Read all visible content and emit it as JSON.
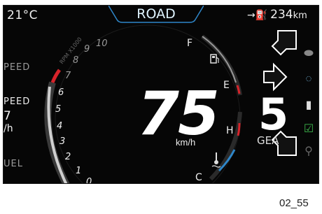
{
  "topbar": {
    "temperature": "21°C",
    "mode": "ROAD",
    "range_value": "234",
    "range_unit": "km"
  },
  "left_panel": {
    "label1": "PEED",
    "label2": "PEED",
    "value": "7",
    "value_unit": "/h",
    "label3": "UEL"
  },
  "tachometer": {
    "label": "RPM X1000",
    "ticks": [
      "0",
      "1",
      "2",
      "3",
      "4",
      "5",
      "6",
      "7",
      "8",
      "9",
      "10"
    ]
  },
  "speed": {
    "value": "75",
    "unit": "km/h"
  },
  "fuel_gauge": {
    "full": "F",
    "empty": "E"
  },
  "temp_gauge": {
    "hot": "H",
    "cold": "C"
  },
  "gear": {
    "value": "5",
    "label": "GEA"
  },
  "caption": "02_55",
  "icons": [
    "fuel-pump-icon",
    "coolant-temp-icon",
    "range-fuel-icon",
    "battery-icon",
    "phone-check-icon",
    "location-pin-icon",
    "chat-icon",
    "helmet-icon"
  ],
  "colors": {
    "accent": "#2f86c8",
    "redline": "#d6232a"
  }
}
